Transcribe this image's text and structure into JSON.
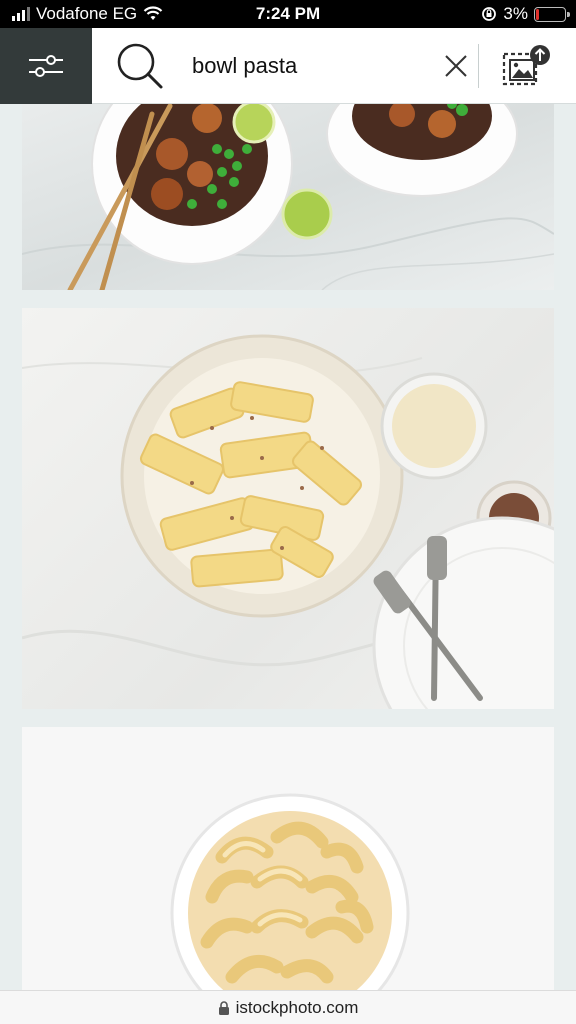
{
  "status_bar": {
    "carrier": "Vodafone EG",
    "time": "7:24 PM",
    "battery_percent": "3%",
    "battery_level": 0.03,
    "icons": [
      "signal-icon",
      "wifi-icon",
      "orientation-lock-icon",
      "battery-icon"
    ]
  },
  "search": {
    "query": "bowl pasta",
    "icons": [
      "filter-sliders-icon",
      "search-icon",
      "clear-icon",
      "image-search-icon"
    ]
  },
  "results": [
    {
      "subject": "soba noodles with chicken, peas and lime in white bowls with chopsticks"
    },
    {
      "subject": "pappardelle pasta in creamy sauce in a bowl with grated parmesan, pepper and forks"
    },
    {
      "subject": "macaroni pasta in a white bowl"
    }
  ],
  "url_bar": {
    "domain": "istockphoto.com",
    "icon": "lock-icon"
  },
  "colors": {
    "status_bg": "#000000",
    "filter_button_bg": "#333a3a",
    "page_bg": "#e8eeee",
    "battery_low": "#e0322c"
  }
}
